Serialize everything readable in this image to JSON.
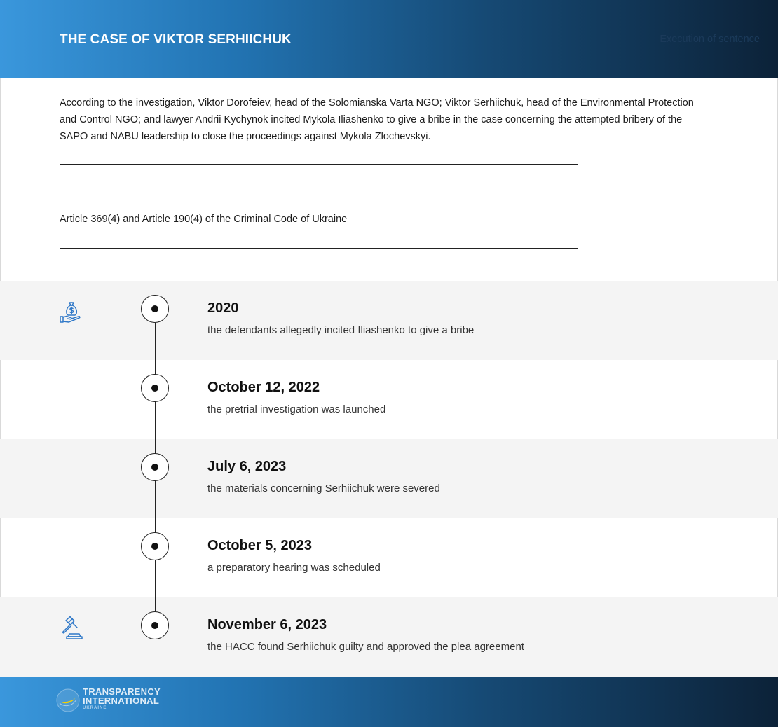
{
  "header": {
    "title": "THE CASE OF VIKTOR SERHIICHUK",
    "status": "Execution of sentence"
  },
  "summary": "According to the investigation, Viktor Dorofeiev, head of the Solomianska Varta NGO; Viktor Serhiichuk, head of the Environmental Protection and Control NGO; and lawyer Andrii Kychynok incited Mykola Iliashenko to give a bribe in the case concerning the attempted bribery of the SAPO and NABU leadership to close the proceedings against Mykola Zlochevskyi.",
  "article": "Article 369(4) and Article 190(4) of the Criminal Code of Ukraine",
  "timeline": [
    {
      "date": "2020",
      "description": "the defendants allegedly incited Iliashenko to give a bribe",
      "icon": "money-bag-hand-icon"
    },
    {
      "date": "October 12, 2022",
      "description": "the pretrial investigation was launched",
      "icon": ""
    },
    {
      "date": "July 6, 2023",
      "description": "the materials concerning Serhiichuk were severed",
      "icon": ""
    },
    {
      "date": "October 5, 2023",
      "description": "a preparatory hearing was scheduled",
      "icon": ""
    },
    {
      "date": "November 6, 2023",
      "description": "the HACC found Serhiichuk guilty and approved the plea agreement",
      "icon": "gavel-icon"
    }
  ],
  "footer": {
    "logo_line1": "TRANSPARENCY",
    "logo_line2": "INTERNATIONAL",
    "logo_line3": "UKRAINE"
  },
  "colors": {
    "header_gradient_start": "#3a97dc",
    "header_gradient_end": "#0c2238",
    "icon_blue": "#2f78c8",
    "logo_yellow": "#f5d000",
    "row_shade": "#f4f4f4"
  }
}
